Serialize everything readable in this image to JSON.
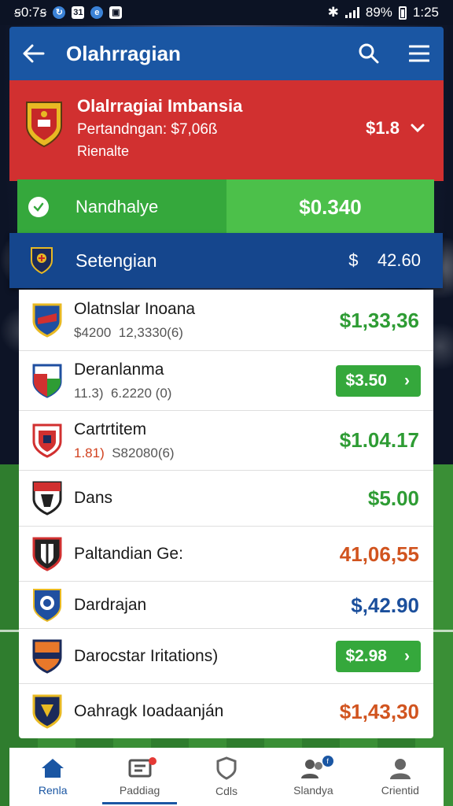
{
  "status_bar": {
    "time_left": "ꞩ0:7ꞩ",
    "battery_percent": "89%",
    "time_right": "1:25"
  },
  "app_bar": {
    "title": "Olahrragian",
    "icons": [
      "back-arrow-icon",
      "search-icon",
      "menu-icon"
    ]
  },
  "featured": {
    "title": "Olalrragiai Imbansia",
    "subtitle": "Pertandngan: $7,06ß",
    "note": "Rienalte",
    "price": "$1.8"
  },
  "highlight_green": {
    "label": "Nandhalye",
    "value": "$0.340"
  },
  "highlight_blue": {
    "label": "Setengian",
    "value_prefix": "$",
    "value": "42.60"
  },
  "list": [
    {
      "name": "Olatnslar Inoana",
      "meta_a": "$4200",
      "meta_b": "12,3330(6)",
      "value": "$1,33,36",
      "color": "green",
      "style": "text",
      "crest": "crest-blue-red"
    },
    {
      "name": "Deranlanma",
      "meta_a": "11.3)",
      "meta_b": "6.2220 (0)",
      "value": "$3.50",
      "color": "green",
      "style": "pill",
      "crest": "crest-red-green"
    },
    {
      "name": "Cartrtitem",
      "meta_a": "1.81)",
      "meta_b": "S82080(6)",
      "value": "$1.04.17",
      "color": "green",
      "style": "text",
      "crest": "crest-red-white"
    },
    {
      "name": "Dans",
      "meta_a": "",
      "meta_b": "",
      "value": "$5.00",
      "color": "green",
      "style": "text",
      "crest": "crest-black-red"
    },
    {
      "name": "Paltandian Ge:",
      "meta_a": "",
      "meta_b": "",
      "value": "41,06,55",
      "color": "orange",
      "style": "text",
      "crest": "crest-black-white"
    },
    {
      "name": "Dardrajan",
      "meta_a": "",
      "meta_b": "",
      "value": "$,42.90",
      "color": "blue",
      "style": "text",
      "crest": "crest-blue-white"
    },
    {
      "name": "Darocstar Iritations)",
      "meta_a": "",
      "meta_b": "",
      "value": "$2.98",
      "color": "green",
      "style": "pill",
      "crest": "crest-orange-navy"
    },
    {
      "name": "Oahragk Ioadaanján",
      "meta_a": "",
      "meta_b": "",
      "value": "$1,43,30",
      "color": "orange",
      "style": "text",
      "crest": "crest-navy-gold"
    }
  ],
  "bottom_nav": [
    {
      "label": "Renla",
      "icon": "home-icon"
    },
    {
      "label": "Paddiag",
      "icon": "scoreboard-icon"
    },
    {
      "label": "Cdls",
      "icon": "shield-icon"
    },
    {
      "label": "Slandya",
      "icon": "users-icon"
    },
    {
      "label": "Crientid",
      "icon": "profile-icon"
    }
  ],
  "colors": {
    "app_bar": "#1a56a3",
    "hero_red": "#d13030",
    "green": "#35a83c",
    "blue_row": "#15468d"
  }
}
